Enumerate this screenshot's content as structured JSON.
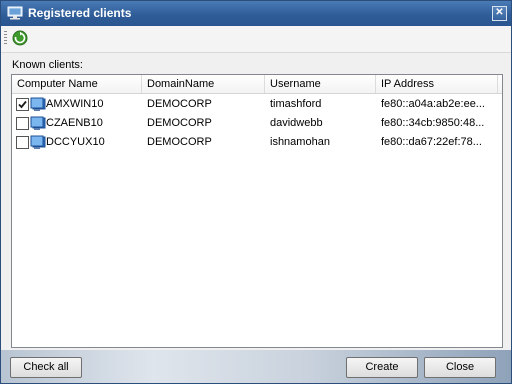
{
  "window": {
    "title": "Registered clients",
    "close_label": "✕"
  },
  "toolbar": {
    "refresh_icon": "refresh-icon"
  },
  "list": {
    "label": "Known clients:",
    "columns": [
      "Computer Name",
      "DomainName",
      "Username",
      "IP Address"
    ],
    "rows": [
      {
        "checked": true,
        "computer": "AMXWIN10",
        "domain": "DEMOCORP",
        "user": "timashford",
        "ip": "fe80::a04a:ab2e:ee..."
      },
      {
        "checked": false,
        "computer": "CZAENB10",
        "domain": "DEMOCORP",
        "user": "davidwebb",
        "ip": "fe80::34cb:9850:48..."
      },
      {
        "checked": false,
        "computer": "DCCYUX10",
        "domain": "DEMOCORP",
        "user": "ishnamohan",
        "ip": "fe80::da67:22ef:78..."
      }
    ]
  },
  "buttons": {
    "check_all": "Check all",
    "create": "Create",
    "close": "Close"
  },
  "colors": {
    "titlebar": "#2f5d98",
    "check": "#1a1a1a"
  }
}
